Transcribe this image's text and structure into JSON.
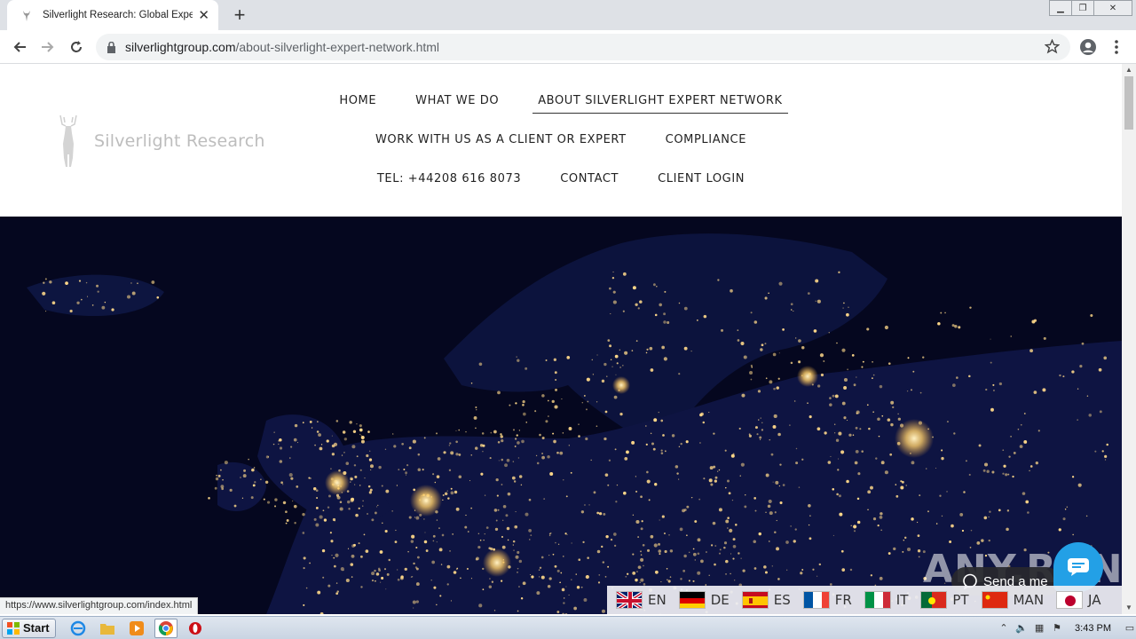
{
  "browser": {
    "tab_title": "Silverlight Research: Global Expert N",
    "url_domain": "silverlightgroup.com",
    "url_path": "/about-silverlight-expert-network.html",
    "status_url": "https://www.silverlightgroup.com/index.html"
  },
  "site": {
    "logo_text": "Silverlight Research",
    "nav_rows": [
      [
        {
          "label": "HOME",
          "active": false
        },
        {
          "label": "WHAT WE DO",
          "active": false
        },
        {
          "label": "ABOUT SILVERLIGHT EXPERT NETWORK",
          "active": true
        }
      ],
      [
        {
          "label": "WORK WITH US AS A CLIENT OR EXPERT",
          "active": false
        },
        {
          "label": "COMPLIANCE",
          "active": false
        }
      ],
      [
        {
          "label": "TEL: +44208 616 8073",
          "active": false
        },
        {
          "label": "CONTACT",
          "active": false
        },
        {
          "label": "CLIENT LOGIN",
          "active": false
        }
      ]
    ],
    "languages": [
      {
        "code": "EN",
        "flag": "uk"
      },
      {
        "code": "DE",
        "flag": "de"
      },
      {
        "code": "ES",
        "flag": "es"
      },
      {
        "code": "FR",
        "flag": "fr"
      },
      {
        "code": "IT",
        "flag": "it"
      },
      {
        "code": "PT",
        "flag": "pt"
      },
      {
        "code": "MAN",
        "flag": "cn"
      },
      {
        "code": "JA",
        "flag": "jp"
      }
    ],
    "chat_label": "Send a me",
    "watermark": "ANY.RUN"
  },
  "taskbar": {
    "start_label": "Start",
    "clock": "3:43 PM"
  },
  "colors": {
    "hero_bg": "#05071f",
    "city_light": "#ffd98a",
    "chat_blue": "#23a0e6"
  }
}
